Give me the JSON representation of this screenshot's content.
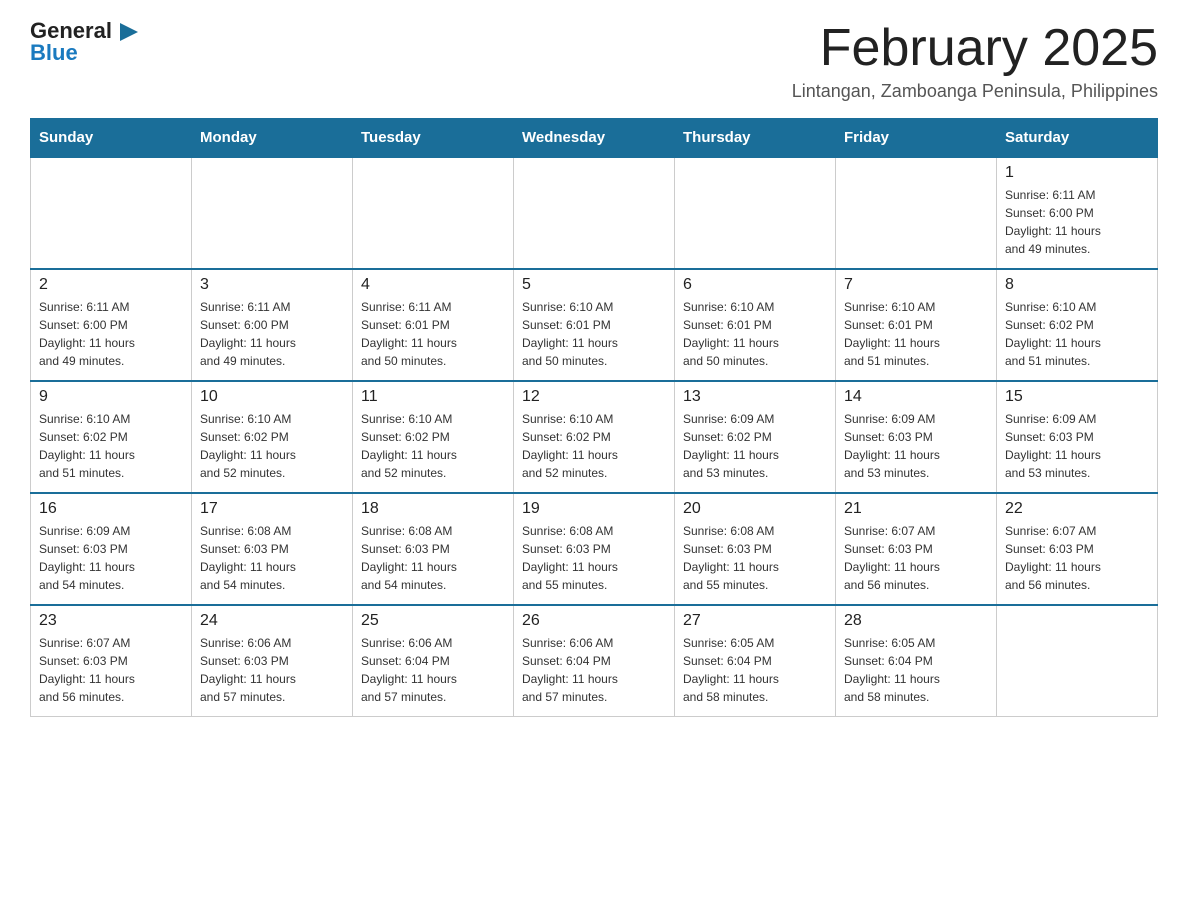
{
  "header": {
    "logo_line1": "General",
    "logo_line2": "Blue",
    "month_title": "February 2025",
    "location": "Lintangan, Zamboanga Peninsula, Philippines"
  },
  "weekdays": [
    "Sunday",
    "Monday",
    "Tuesday",
    "Wednesday",
    "Thursday",
    "Friday",
    "Saturday"
  ],
  "weeks": [
    [
      {
        "day": "",
        "info": ""
      },
      {
        "day": "",
        "info": ""
      },
      {
        "day": "",
        "info": ""
      },
      {
        "day": "",
        "info": ""
      },
      {
        "day": "",
        "info": ""
      },
      {
        "day": "",
        "info": ""
      },
      {
        "day": "1",
        "info": "Sunrise: 6:11 AM\nSunset: 6:00 PM\nDaylight: 11 hours\nand 49 minutes."
      }
    ],
    [
      {
        "day": "2",
        "info": "Sunrise: 6:11 AM\nSunset: 6:00 PM\nDaylight: 11 hours\nand 49 minutes."
      },
      {
        "day": "3",
        "info": "Sunrise: 6:11 AM\nSunset: 6:00 PM\nDaylight: 11 hours\nand 49 minutes."
      },
      {
        "day": "4",
        "info": "Sunrise: 6:11 AM\nSunset: 6:01 PM\nDaylight: 11 hours\nand 50 minutes."
      },
      {
        "day": "5",
        "info": "Sunrise: 6:10 AM\nSunset: 6:01 PM\nDaylight: 11 hours\nand 50 minutes."
      },
      {
        "day": "6",
        "info": "Sunrise: 6:10 AM\nSunset: 6:01 PM\nDaylight: 11 hours\nand 50 minutes."
      },
      {
        "day": "7",
        "info": "Sunrise: 6:10 AM\nSunset: 6:01 PM\nDaylight: 11 hours\nand 51 minutes."
      },
      {
        "day": "8",
        "info": "Sunrise: 6:10 AM\nSunset: 6:02 PM\nDaylight: 11 hours\nand 51 minutes."
      }
    ],
    [
      {
        "day": "9",
        "info": "Sunrise: 6:10 AM\nSunset: 6:02 PM\nDaylight: 11 hours\nand 51 minutes."
      },
      {
        "day": "10",
        "info": "Sunrise: 6:10 AM\nSunset: 6:02 PM\nDaylight: 11 hours\nand 52 minutes."
      },
      {
        "day": "11",
        "info": "Sunrise: 6:10 AM\nSunset: 6:02 PM\nDaylight: 11 hours\nand 52 minutes."
      },
      {
        "day": "12",
        "info": "Sunrise: 6:10 AM\nSunset: 6:02 PM\nDaylight: 11 hours\nand 52 minutes."
      },
      {
        "day": "13",
        "info": "Sunrise: 6:09 AM\nSunset: 6:02 PM\nDaylight: 11 hours\nand 53 minutes."
      },
      {
        "day": "14",
        "info": "Sunrise: 6:09 AM\nSunset: 6:03 PM\nDaylight: 11 hours\nand 53 minutes."
      },
      {
        "day": "15",
        "info": "Sunrise: 6:09 AM\nSunset: 6:03 PM\nDaylight: 11 hours\nand 53 minutes."
      }
    ],
    [
      {
        "day": "16",
        "info": "Sunrise: 6:09 AM\nSunset: 6:03 PM\nDaylight: 11 hours\nand 54 minutes."
      },
      {
        "day": "17",
        "info": "Sunrise: 6:08 AM\nSunset: 6:03 PM\nDaylight: 11 hours\nand 54 minutes."
      },
      {
        "day": "18",
        "info": "Sunrise: 6:08 AM\nSunset: 6:03 PM\nDaylight: 11 hours\nand 54 minutes."
      },
      {
        "day": "19",
        "info": "Sunrise: 6:08 AM\nSunset: 6:03 PM\nDaylight: 11 hours\nand 55 minutes."
      },
      {
        "day": "20",
        "info": "Sunrise: 6:08 AM\nSunset: 6:03 PM\nDaylight: 11 hours\nand 55 minutes."
      },
      {
        "day": "21",
        "info": "Sunrise: 6:07 AM\nSunset: 6:03 PM\nDaylight: 11 hours\nand 56 minutes."
      },
      {
        "day": "22",
        "info": "Sunrise: 6:07 AM\nSunset: 6:03 PM\nDaylight: 11 hours\nand 56 minutes."
      }
    ],
    [
      {
        "day": "23",
        "info": "Sunrise: 6:07 AM\nSunset: 6:03 PM\nDaylight: 11 hours\nand 56 minutes."
      },
      {
        "day": "24",
        "info": "Sunrise: 6:06 AM\nSunset: 6:03 PM\nDaylight: 11 hours\nand 57 minutes."
      },
      {
        "day": "25",
        "info": "Sunrise: 6:06 AM\nSunset: 6:04 PM\nDaylight: 11 hours\nand 57 minutes."
      },
      {
        "day": "26",
        "info": "Sunrise: 6:06 AM\nSunset: 6:04 PM\nDaylight: 11 hours\nand 57 minutes."
      },
      {
        "day": "27",
        "info": "Sunrise: 6:05 AM\nSunset: 6:04 PM\nDaylight: 11 hours\nand 58 minutes."
      },
      {
        "day": "28",
        "info": "Sunrise: 6:05 AM\nSunset: 6:04 PM\nDaylight: 11 hours\nand 58 minutes."
      },
      {
        "day": "",
        "info": ""
      }
    ]
  ]
}
